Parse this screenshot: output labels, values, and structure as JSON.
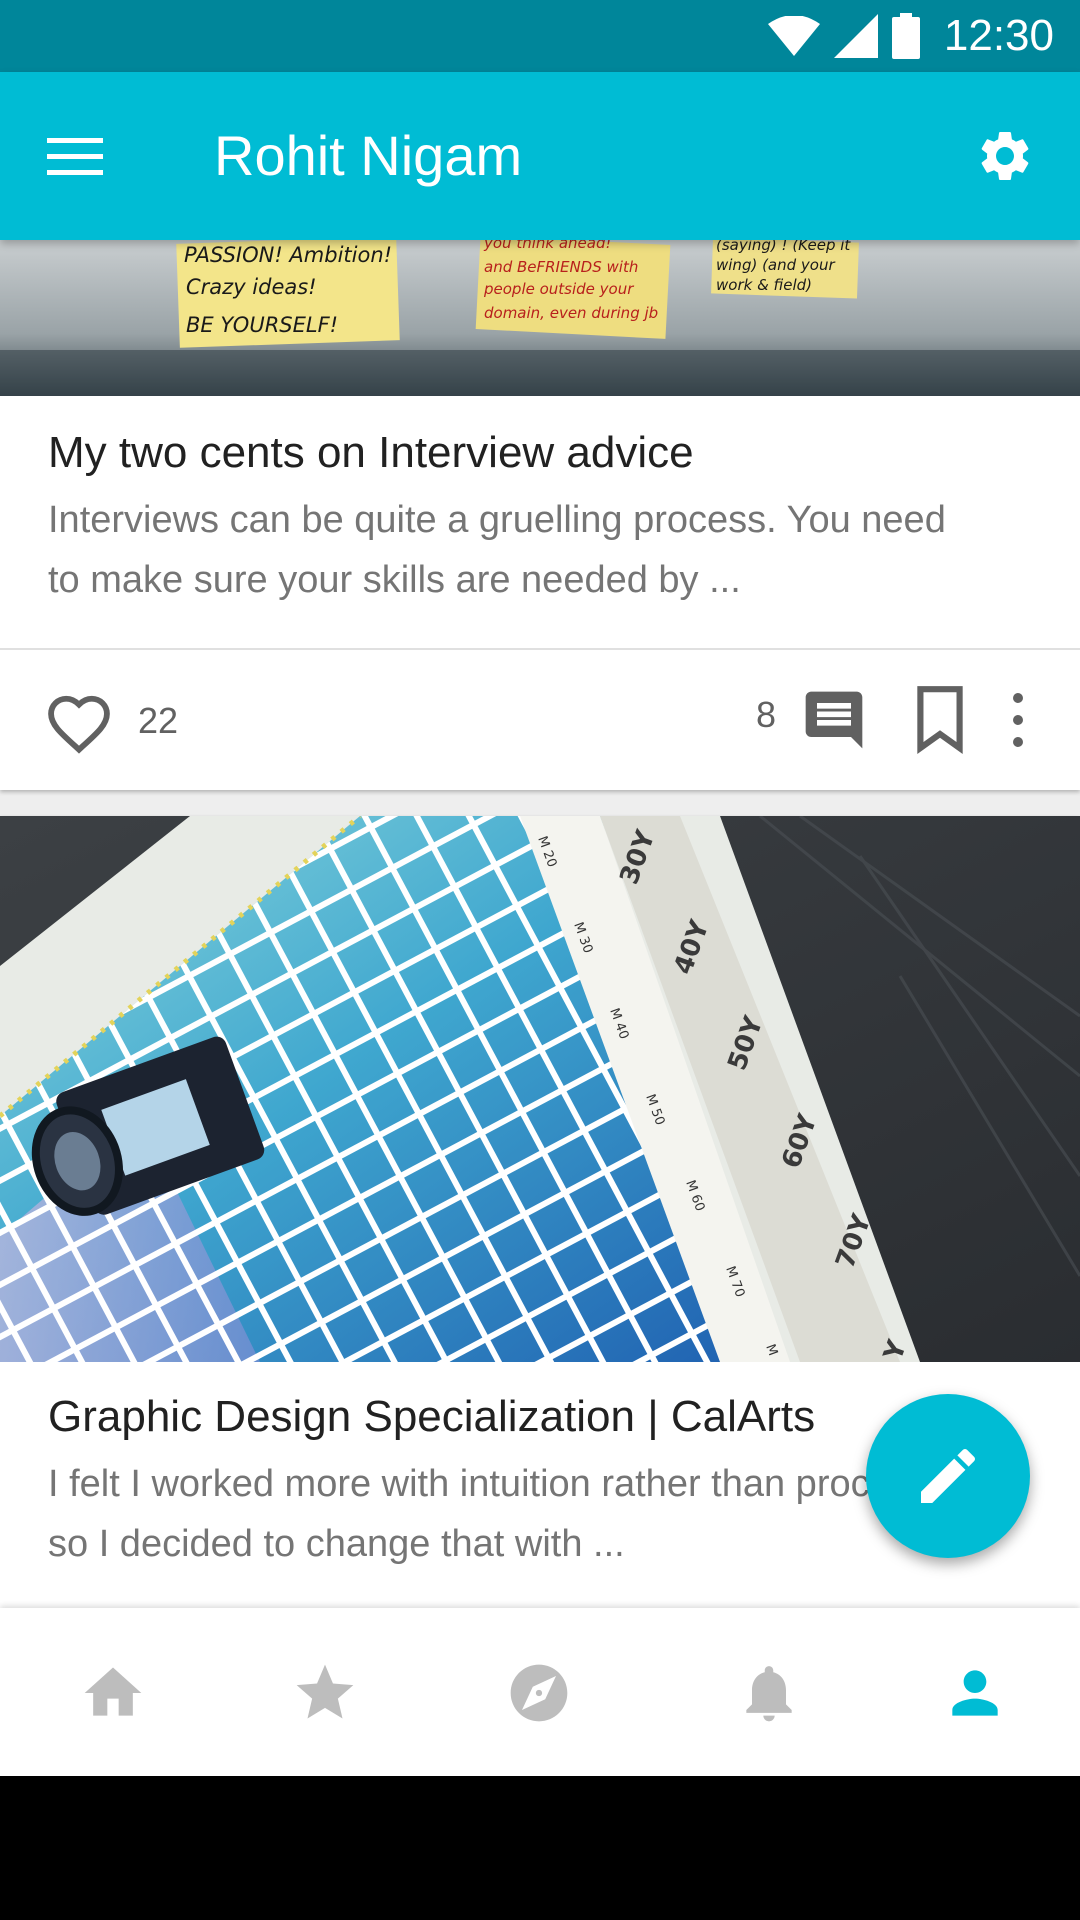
{
  "status_bar": {
    "time": "12:30",
    "icons": [
      "wifi-icon",
      "cell-signal-icon",
      "battery-icon"
    ]
  },
  "app_bar": {
    "title": "Rohit Nigam",
    "menu_icon": "menu-icon",
    "settings_icon": "gear-icon",
    "color": "#00bcd4"
  },
  "feed": {
    "posts": [
      {
        "image": "sticky-notes-photo",
        "title": "My two cents on Interview advice",
        "excerpt": "Interviews can be quite a gruelling process. You need to make sure your skills are needed by ...",
        "likes": "22",
        "comments": "8"
      },
      {
        "image": "color-swatch-photo",
        "title": "Graphic Design Specialization | CalArts",
        "excerpt": "I felt I worked more with intuition rather than process, so I decided to change that with ..."
      }
    ]
  },
  "image_text": {
    "note1": [
      "PASSION! Ambition!",
      "Crazy ideas!",
      "BE YOURSELF!"
    ],
    "note2": [
      "you think ahead!",
      "and BeFRIENDS with",
      "people outside your",
      "domain, even during jb"
    ],
    "note3": [
      "(saying) ! (Keep it",
      "wing) (and your",
      "work & field)"
    ],
    "swatch_m": [
      "M 20",
      "M 30",
      "M 40",
      "M 50",
      "M 60",
      "M 70",
      "M"
    ],
    "swatch_y": [
      "30Y",
      "40Y",
      "50Y",
      "60Y",
      "70Y",
      "Y"
    ]
  },
  "fab": {
    "icon": "pencil-icon"
  },
  "bottom_nav": {
    "items": [
      {
        "icon": "home-icon",
        "active": false
      },
      {
        "icon": "star-icon",
        "active": false
      },
      {
        "icon": "compass-icon",
        "active": false
      },
      {
        "icon": "bell-icon",
        "active": false
      },
      {
        "icon": "person-icon",
        "active": true
      }
    ],
    "active_color": "#00bcd4",
    "inactive_color": "#bdbdbd"
  }
}
